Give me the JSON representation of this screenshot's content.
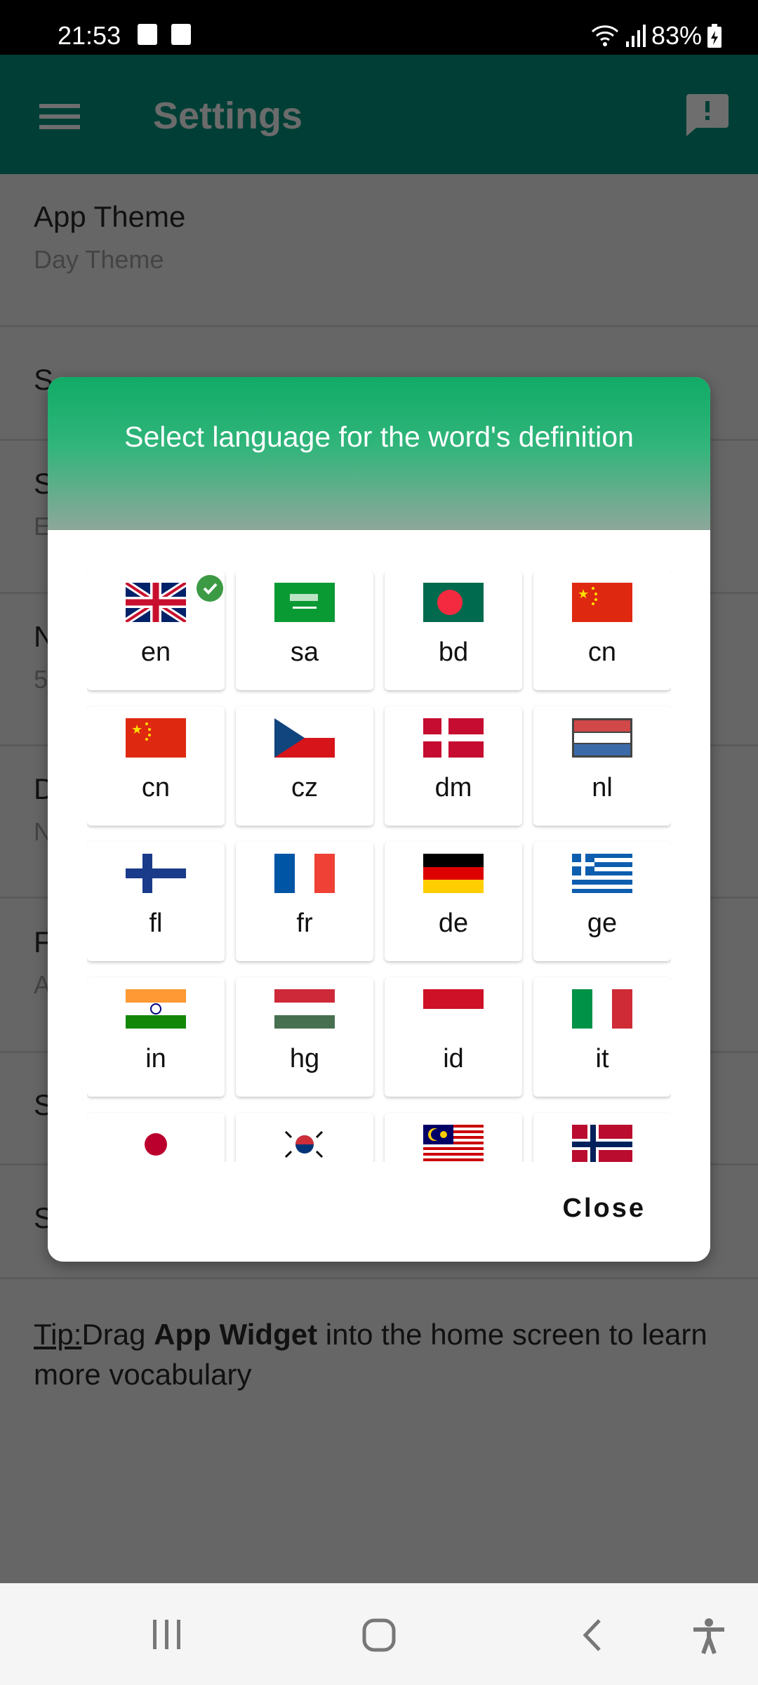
{
  "status_bar": {
    "time": "21:53",
    "battery": "83%",
    "icons": [
      "gallery-icon",
      "clock-icon",
      "wifi-icon",
      "signal-icon",
      "battery-charging-icon"
    ]
  },
  "app_bar": {
    "title": "Settings",
    "menu_icon": "hamburger-menu-icon",
    "feedback_icon": "feedback-icon"
  },
  "settings": [
    {
      "title": "App Theme",
      "subtitle": "Day Theme"
    },
    {
      "title": "S",
      "subtitle": ""
    },
    {
      "title": "S",
      "subtitle": "E"
    },
    {
      "title": "N",
      "subtitle": "5"
    },
    {
      "title": "D",
      "subtitle": "N"
    },
    {
      "title": "F",
      "subtitle": "A"
    },
    {
      "title": "S",
      "subtitle": ""
    },
    {
      "title": "S",
      "subtitle": ""
    }
  ],
  "tip": {
    "prefix": "Tip:",
    "text1": "Drag ",
    "bold": "App Widget",
    "text2": " into the home screen to learn more vocabulary"
  },
  "dialog": {
    "title": "Select language for the word's definition",
    "selected": "en",
    "languages": [
      {
        "code": "en",
        "flag": "uk"
      },
      {
        "code": "sa",
        "flag": "sa"
      },
      {
        "code": "bd",
        "flag": "bd"
      },
      {
        "code": "cn",
        "flag": "cn"
      },
      {
        "code": "cn",
        "flag": "cn"
      },
      {
        "code": "cz",
        "flag": "cz"
      },
      {
        "code": "dm",
        "flag": "dk"
      },
      {
        "code": "nl",
        "flag": "nl"
      },
      {
        "code": "fl",
        "flag": "fi"
      },
      {
        "code": "fr",
        "flag": "fr"
      },
      {
        "code": "de",
        "flag": "de"
      },
      {
        "code": "ge",
        "flag": "gr"
      },
      {
        "code": "in",
        "flag": "in"
      },
      {
        "code": "hg",
        "flag": "hu"
      },
      {
        "code": "id",
        "flag": "id"
      },
      {
        "code": "it",
        "flag": "it"
      },
      {
        "code": "",
        "flag": "jp"
      },
      {
        "code": "",
        "flag": "kr"
      },
      {
        "code": "",
        "flag": "my"
      },
      {
        "code": "",
        "flag": "no"
      }
    ],
    "close_label": "Close",
    "accent": "#10ab66"
  },
  "nav_bar": {
    "icons": [
      "recent-apps-icon",
      "home-icon",
      "back-icon",
      "accessibility-icon"
    ]
  }
}
